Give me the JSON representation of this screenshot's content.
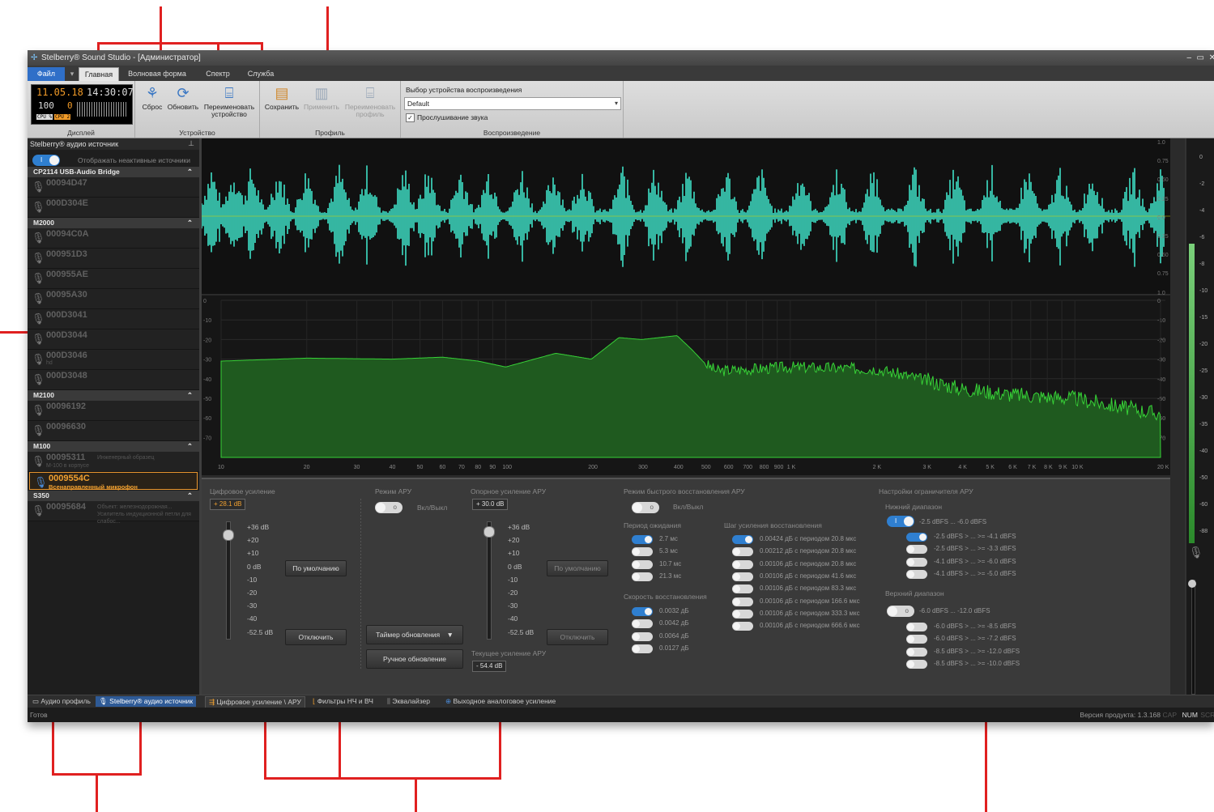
{
  "window": {
    "title": "Stelberry® Sound Studio - [Администратор]",
    "controls": [
      "–",
      "▭",
      "✕"
    ]
  },
  "menu": {
    "file": "Файл",
    "tabs": [
      "Главная",
      "Волновая форма",
      "Спектр",
      "Служба"
    ]
  },
  "ribbon": {
    "display": {
      "date": "11.05.18",
      "time": "14:30:07",
      "num1": "100",
      "num2": "0",
      "cpu": "CPU %",
      "cpu2": "CPU 2",
      "label": "Дисплей"
    },
    "device": {
      "label": "Устройство",
      "reset": "Сброс",
      "refresh": "Обновить",
      "rename": "Переименовать устройство"
    },
    "profile": {
      "label": "Профиль",
      "save": "Сохранить",
      "apply": "Применить",
      "rename": "Переименовать профиль"
    },
    "playback": {
      "label": "Воспроизведение",
      "select_title": "Выбор устройства воспроизведения",
      "selected": "Default",
      "listen": "Прослушивание звука"
    }
  },
  "left_panel": {
    "title": "Stelberry® аудио источник",
    "show_inactive": "Отображать неактивные источники",
    "groups": [
      {
        "name": "CP2114 USB-Audio Bridge",
        "devices": [
          {
            "id": "00094D47"
          },
          {
            "id": "000D304E"
          }
        ]
      },
      {
        "name": "M2000",
        "devices": [
          {
            "id": "00094C0A"
          },
          {
            "id": "000951D3"
          },
          {
            "id": "000955AE"
          },
          {
            "id": "00095A30"
          },
          {
            "id": "000D3041"
          },
          {
            "id": "000D3044"
          },
          {
            "id": "000D3046",
            "sub": "hd"
          },
          {
            "id": "000D3048"
          }
        ]
      },
      {
        "name": "M2100",
        "devices": [
          {
            "id": "00096192"
          },
          {
            "id": "00096630"
          }
        ]
      },
      {
        "name": "M100",
        "devices": [
          {
            "id": "00095311",
            "note": "Инженерный образец",
            "sub": "M-100 в корпусе"
          },
          {
            "id": "0009554C",
            "sub": "Всенаправленный микрофон",
            "selected": true
          }
        ]
      },
      {
        "name": "S350",
        "devices": [
          {
            "id": "00095684",
            "note": "Объект: железнодорожная... Усилитель индукционной петли для слабос..."
          }
        ]
      }
    ]
  },
  "wave": {
    "scale": [
      "1.0",
      "0.75",
      "0.50",
      "0.25",
      "0.0",
      "0.25",
      "0.50",
      "0.75",
      "1.0"
    ]
  },
  "spectrum": {
    "yticks": [
      "0",
      "-10",
      "-20",
      "-30",
      "-40",
      "-50",
      "-60",
      "-70"
    ],
    "xticks": [
      "10",
      "20",
      "30",
      "40",
      "50",
      "60",
      "70",
      "80",
      "90",
      "100",
      "200",
      "300",
      "400",
      "500",
      "600",
      "700",
      "800",
      "900",
      "1 K",
      "2 K",
      "3 K",
      "4 K",
      "5 K",
      "6 K",
      "7 K",
      "8 K",
      "9 K",
      "10 K",
      "20 K"
    ]
  },
  "controls": {
    "digital_gain": {
      "title": "Цифровое усиление",
      "value": "+ 28.1 dB",
      "default_btn": "По умолчанию",
      "off_btn": "Отключить",
      "scale": [
        "+36 dB",
        "+20",
        "+10",
        "0 dB",
        "-10",
        "-20",
        "-30",
        "-40",
        "-52.5 dB"
      ]
    },
    "agc": {
      "title": "Режим АРУ",
      "toggle": "Вкл/Выкл",
      "timer_btn": "Таймер обновления",
      "manual_btn": "Ручное обновление"
    },
    "ref_gain": {
      "title": "Опорное усиление АРУ",
      "value": "+ 30.0 dB",
      "default_btn": "По умолчанию",
      "off_btn": "Отключить",
      "current_title": "Текущее усиление АРУ",
      "current_value": "- 54.4 dB",
      "scale": [
        "+36 dB",
        "+20",
        "+10",
        "0 dB",
        "-10",
        "-20",
        "-30",
        "-40",
        "-52.5 dB"
      ]
    },
    "fast_recovery": {
      "title": "Режим быстрого восстановления АРУ",
      "toggle": "Вкл/Выкл",
      "wait_title": "Период ожидания",
      "wait": [
        "2.7 мс",
        "5.3 мс",
        "10.7 мс",
        "21.3 мс"
      ],
      "speed_title": "Скорость восстановления",
      "speed": [
        "0.0032 дБ",
        "0.0042 дБ",
        "0.0064 дБ",
        "0.0127 дБ"
      ],
      "step_title": "Шаг усиления восстановления",
      "steps": [
        "0.00424 дБ с периодом 20.8 мкс",
        "0.00212 дБ с периодом 20.8 мкс",
        "0.00106 дБ с периодом 20.8 мкс",
        "0.00106 дБ с периодом 41.6 мкс",
        "0.00106 дБ с периодом 83.3 мкс",
        "0.00106 дБ с периодом 166.6 мкс",
        "0.00106 дБ с периодом 333.3 мкс",
        "0.00106 дБ с периодом 666.6 мкс"
      ]
    },
    "limiter": {
      "title": "Настройки ограничителя АРУ",
      "low_title": "Нижний диапазон",
      "low_main": "-2.5 dBFS ... -6.0 dBFS",
      "low": [
        "-2.5 dBFS > ... >= -4.1 dBFS",
        "-2.5 dBFS > ... >= -3.3 dBFS",
        "-4.1 dBFS > ... >= -6.0 dBFS",
        "-4.1 dBFS > ... >= -5.0 dBFS"
      ],
      "high_title": "Верхний диапазон",
      "high_main": "-6.0 dBFS ... -12.0 dBFS",
      "high": [
        "-6.0 dBFS > ... >= -8.5 dBFS",
        "-6.0 dBFS > ... >= -7.2 dBFS",
        "-8.5 dBFS > ... >= -12.0 dBFS",
        "-8.5 dBFS > ... >= -10.0 dBFS"
      ]
    }
  },
  "bottom_tabs": {
    "left": [
      "Аудио профиль",
      "Stelberry® аудио источник"
    ],
    "main": [
      "Цифровое усиление \\ АРУ",
      "Фильтры НЧ и ВЧ",
      "Эквалайзер",
      "Выходное аналоговое усиление"
    ]
  },
  "status": {
    "ready": "Готов",
    "version": "Версия продукта: 1.3.168",
    "cap": "CAP",
    "num": "NUM",
    "scrl": "SCRL"
  },
  "meter": {
    "scale": [
      "0",
      "-2",
      "-4",
      "-6",
      "-8",
      "-10",
      "-15",
      "-20",
      "-25",
      "-30",
      "-35",
      "-40",
      "-50",
      "-60",
      "-88"
    ]
  },
  "colors": {
    "wave": "#3fe0c6",
    "spectrum": "#1f5a1f",
    "accent": "#2f7fd0",
    "selected": "#f0a030",
    "callout": "#e02020"
  }
}
